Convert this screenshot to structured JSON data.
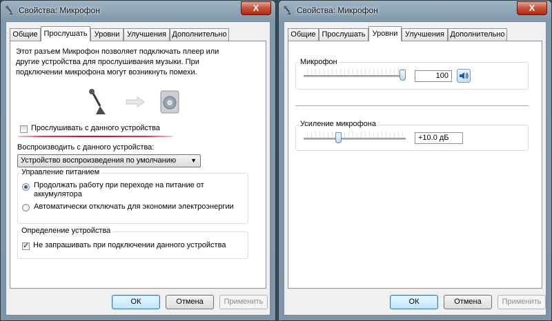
{
  "left_window": {
    "title": "Свойства: Микрофон",
    "close_label": "X",
    "tabs": [
      "Общие",
      "Прослушать",
      "Уровни",
      "Улучшения",
      "Дополнительно"
    ],
    "active_tab": "Прослушать",
    "listen": {
      "description": "Этот разъем Микрофон позволяет подключать плеер или другие устройства для прослушивания музыки. При подключении микрофона могут возникнуть помехи.",
      "listen_checkbox_label": "Прослушивать с данного устройства",
      "listen_checked": false,
      "playback_label": "Воспроизводить с данного устройства:",
      "playback_device": "Устройство воспроизведения по умолчанию",
      "power_group_title": "Управление питанием",
      "power_option_1": "Продолжать работу при переходе на питание от аккумулятора",
      "power_option_2": "Автоматически отключать для экономии электроэнергии",
      "detect_group_title": "Определение устройства",
      "detect_checkbox_label": "Не запрашивать при подключении данного устройства",
      "detect_checked": true
    },
    "buttons": {
      "ok": "ОК",
      "cancel": "Отмена",
      "apply": "Применить"
    }
  },
  "right_window": {
    "title": "Свойства: Микрофон",
    "close_label": "X",
    "tabs": [
      "Общие",
      "Прослушать",
      "Уровни",
      "Улучшения",
      "Дополнительно"
    ],
    "active_tab": "Уровни",
    "levels": {
      "mic_label": "Микрофон",
      "mic_value": "100",
      "mic_level_fraction": 1.0,
      "boost_label": "Усиление микрофона",
      "boost_value": "+10.0 дБ",
      "boost_level_fraction": 0.33
    },
    "buttons": {
      "ok": "ОК",
      "cancel": "Отмена",
      "apply": "Применить"
    }
  },
  "colors": {
    "annotation_red": "#d4121d",
    "radio_accent": "#1d5fa8"
  }
}
